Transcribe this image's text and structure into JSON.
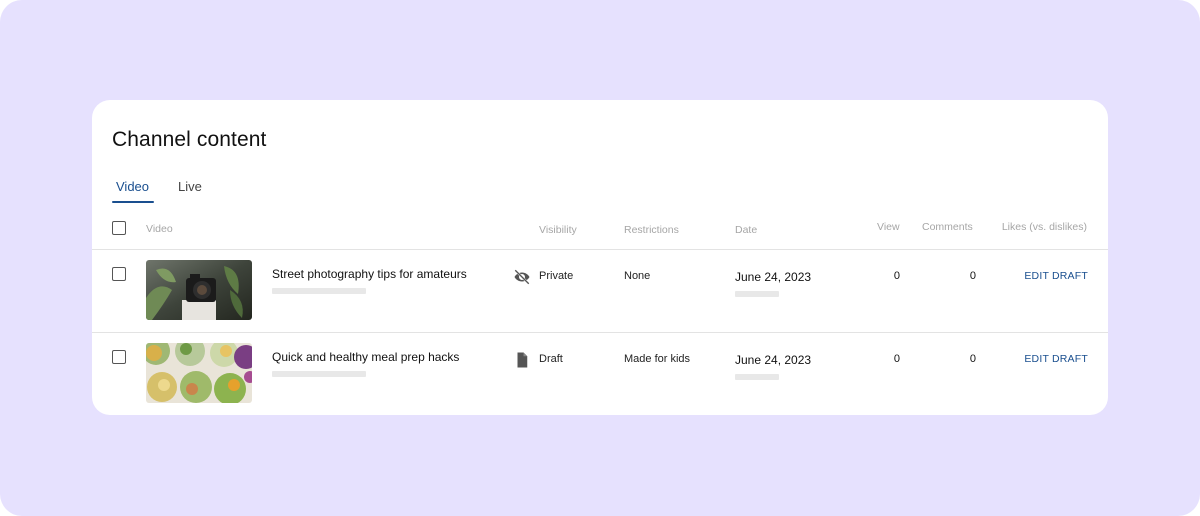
{
  "page": {
    "title": "Channel content"
  },
  "tabs": [
    {
      "label": "Video",
      "active": true
    },
    {
      "label": "Live",
      "active": false
    }
  ],
  "table": {
    "headers": {
      "video": "Video",
      "visibility": "Visibility",
      "restrictions": "Restrictions",
      "date": "Date",
      "view": "View",
      "comments": "Comments",
      "likes": "Likes (vs. dislikes)"
    },
    "rows": [
      {
        "title": "Street photography tips for amateurs",
        "visibility": "Private",
        "visibility_icon": "eye-off-icon",
        "restrictions": "None",
        "date": "June 24, 2023",
        "views": "0",
        "comments": "0",
        "action": "EDIT DRAFT",
        "thumbnail": "camera-photo"
      },
      {
        "title": "Quick and healthy meal prep hacks",
        "visibility": "Draft",
        "visibility_icon": "document-icon",
        "restrictions": "Made for kids",
        "date": "June 24, 2023",
        "views": "0",
        "comments": "0",
        "action": "EDIT DRAFT",
        "thumbnail": "food-bowls-photo"
      }
    ]
  },
  "colors": {
    "background": "#e6e1fe",
    "accent": "#1a4f8f",
    "card": "#ffffff"
  }
}
